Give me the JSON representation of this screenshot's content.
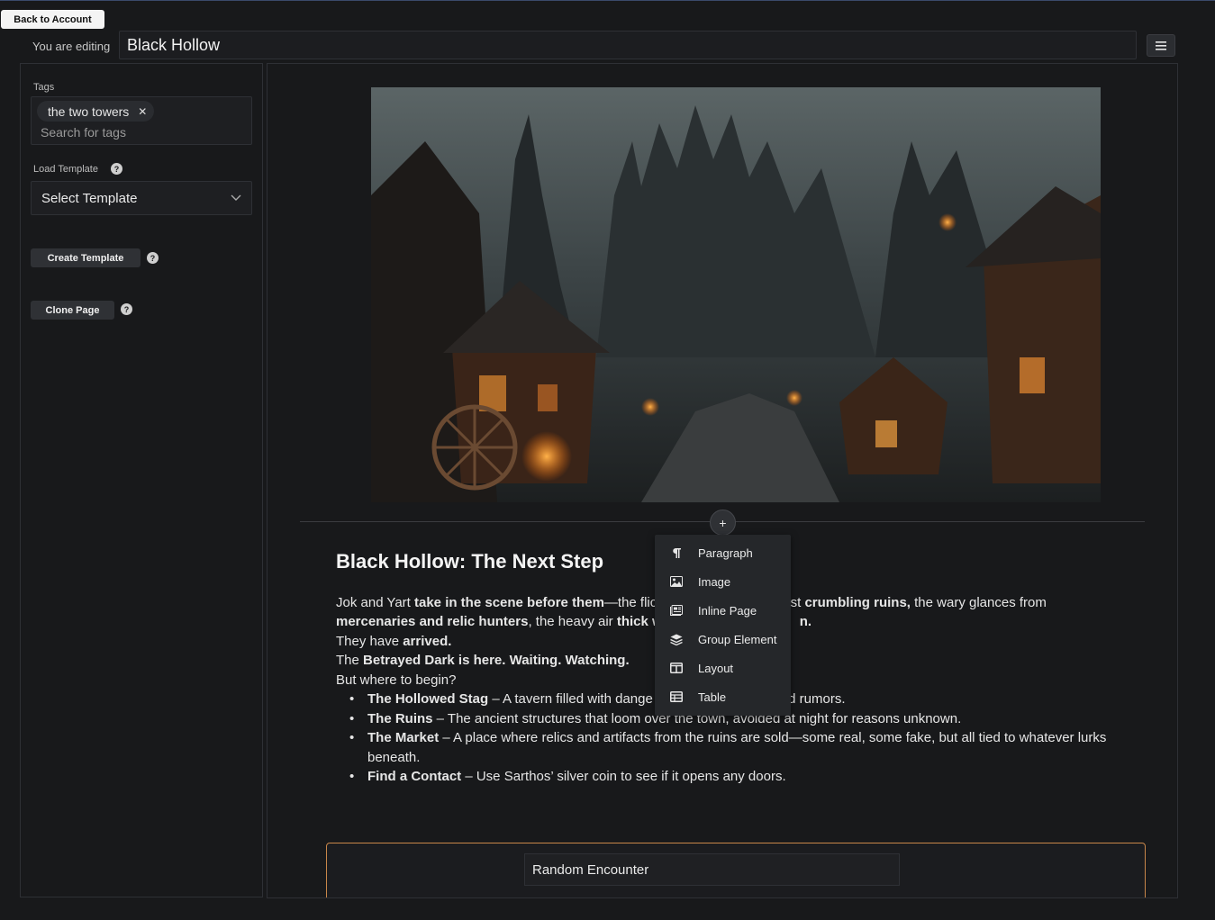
{
  "header": {
    "back_label": "Back to Account",
    "editing_label": "You are editing",
    "page_title": "Black Hollow"
  },
  "sidebar": {
    "tags_label": "Tags",
    "tags": [
      "the two towers"
    ],
    "tags_placeholder": "Search for tags",
    "load_template_label": "Load Template",
    "template_select": "Select Template",
    "create_template": "Create Template",
    "clone_page": "Clone Page"
  },
  "article": {
    "title": "Black Hollow: The Next Step",
    "p1_a": "Jok and Yart ",
    "p1_b": "take in the scene before them",
    "p1_c": "—the flic",
    "p1_d": "nst ",
    "p1_e": "crumbling ruins,",
    "p1_f": " the wary glances from",
    "p2_a": "mercenaries and relic hunters",
    "p2_b": ", the heavy air ",
    "p2_c": "thick w",
    "p2_d": "n.",
    "p3_a": "They have ",
    "p3_b": "arrived.",
    "p4_a": "The ",
    "p4_b": "Betrayed Dark is here. Waiting. Watching.",
    "p5": "But where to begin?",
    "list": [
      {
        "title": "The Hollowed Stag",
        "text": " – A tavern filled with dange",
        "tail": "ed rumors."
      },
      {
        "title": "The Ruins",
        "text": " – The ancient structures that loom over the town, avoided at night for reasons unknown.",
        "tail": ""
      },
      {
        "title": "The Market",
        "text": " – A place where relics and artifacts from the ruins are sold—some real, some fake, but all tied to whatever lurks beneath.",
        "tail": ""
      },
      {
        "title": "Find a Contact",
        "text": " – Use Sarthos’ silver coin to see if it opens any doors.",
        "tail": ""
      }
    ]
  },
  "encounter": {
    "value": "Random Encounter"
  },
  "add_menu": {
    "items": [
      {
        "label": "Paragraph",
        "icon": "paragraph-icon"
      },
      {
        "label": "Image",
        "icon": "image-icon"
      },
      {
        "label": "Inline Page",
        "icon": "inline-page-icon"
      },
      {
        "label": "Group Element",
        "icon": "layers-icon"
      },
      {
        "label": "Layout",
        "icon": "layout-icon"
      },
      {
        "label": "Table",
        "icon": "table-icon"
      }
    ]
  },
  "colors": {
    "accent_border": "#c9874a",
    "background": "#18191b"
  }
}
